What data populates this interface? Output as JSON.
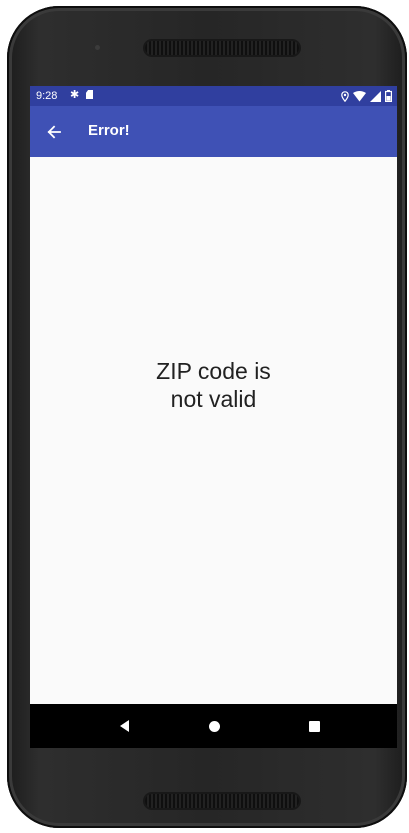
{
  "status_bar": {
    "time": "9:28",
    "icons": [
      "settings-icon",
      "sd-card-icon",
      "location-icon",
      "wifi-icon",
      "signal-icon",
      "battery-icon"
    ]
  },
  "app_bar": {
    "back_icon": "arrow-left-icon",
    "title": "Error!"
  },
  "content": {
    "message_line_1": "ZIP code is",
    "message_line_2": "not valid"
  },
  "nav_bar": {
    "items": [
      "back-icon",
      "home-icon",
      "recents-icon"
    ]
  },
  "colors": {
    "status_bar": "#303f9f",
    "app_bar": "#3f51b5",
    "background": "#fafafa",
    "text": "#212121",
    "nav_bar": "#000000"
  }
}
